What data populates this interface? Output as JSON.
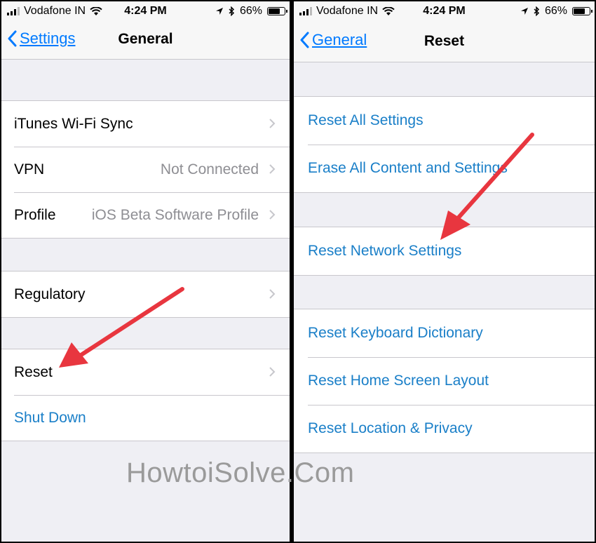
{
  "status_bar": {
    "carrier": "Vodafone IN",
    "time": "4:24 PM",
    "battery": "66%",
    "battery_level": 0.66
  },
  "left_screen": {
    "back_label": "Settings",
    "title": "General",
    "rows": [
      {
        "label": "iTunes Wi-Fi Sync",
        "detail": ""
      },
      {
        "label": "VPN",
        "detail": "Not Connected"
      },
      {
        "label": "Profile",
        "detail": "iOS Beta Software Profile"
      },
      {
        "label": "Regulatory",
        "detail": ""
      },
      {
        "label": "Reset",
        "detail": ""
      },
      {
        "label": "Shut Down",
        "detail": ""
      }
    ]
  },
  "right_screen": {
    "back_label": "General",
    "title": "Reset",
    "rows": [
      {
        "label": "Reset All Settings"
      },
      {
        "label": "Erase All Content and Settings"
      },
      {
        "label": "Reset Network Settings"
      },
      {
        "label": "Reset Keyboard Dictionary"
      },
      {
        "label": "Reset Home Screen Layout"
      },
      {
        "label": "Reset Location & Privacy"
      }
    ]
  },
  "watermark": "HowtoiSolve.Com",
  "colors": {
    "ios_blue": "#007aff",
    "link_blue": "#1a7fc8",
    "arrow_red": "#e8363f",
    "group_bg": "#efeff4"
  }
}
